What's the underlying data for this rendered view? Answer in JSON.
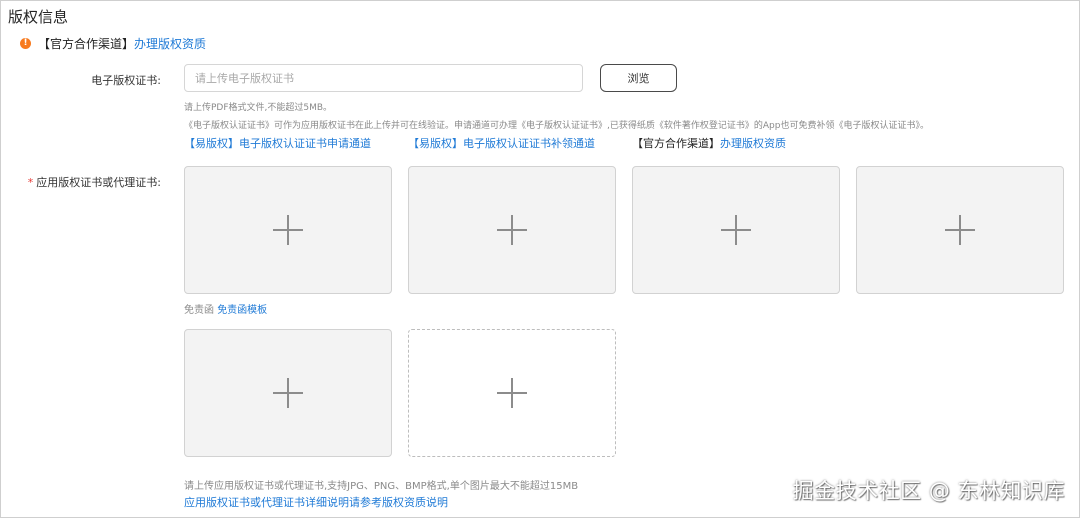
{
  "section": {
    "title": "版权信息"
  },
  "notice": {
    "bracket_text": "【官方合作渠道】",
    "link_text": "办理版权资质",
    "icon": "warning-circle-icon",
    "icon_color": "#f77a1f"
  },
  "electronic_cert": {
    "label": "电子版权证书:",
    "input_placeholder": "请上传电子版权证书",
    "input_value": "",
    "browse_label": "浏览",
    "hint_line1": "请上传PDF格式文件,不能超过5MB。",
    "hint_line2": "《电子版权认证证书》可作为应用版权证书在此上传并可在线验证。申请通道可办理《电子版权认证证书》,已获得纸质《软件著作权登记证书》的App也可免费补领《电子版权认证证书》。",
    "channels": [
      {
        "bracket": "【易版权】",
        "text": "电子版权认证证书申请通道"
      },
      {
        "bracket": "【易版权】",
        "text": "电子版权认证证书补领通道"
      },
      {
        "bracket": "【官方合作渠道】",
        "text": "办理版权资质"
      }
    ]
  },
  "app_cert": {
    "required_mark": "*",
    "label": "应用版权证书或代理证书:",
    "upload_icon": "plus-icon",
    "upload_tile_count": 6,
    "disclaimer_prefix": "免责函",
    "disclaimer_link": "免责函模板",
    "footer_hint": "请上传应用版权证书或代理证书,支持JPG、PNG、BMP格式,单个图片最大不能超过15MB",
    "footer_link": "应用版权证书或代理证书详细说明请参考版权资质说明"
  },
  "colors": {
    "link": "#1f7ad6",
    "required": "#e53935",
    "hint": "#8a8a8a"
  },
  "watermark": "掘金技术社区 @ 东林知识库"
}
